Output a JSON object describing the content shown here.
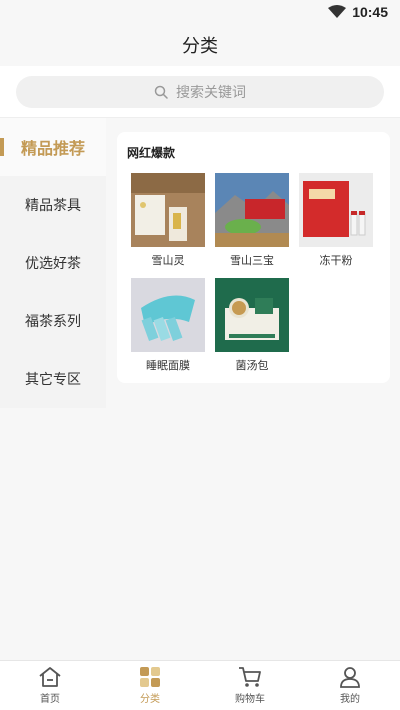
{
  "status": {
    "time": "10:45"
  },
  "header": {
    "title": "分类"
  },
  "search": {
    "placeholder": "搜索关键词"
  },
  "sidebar": {
    "items": [
      {
        "label": "精品推荐",
        "active": true
      },
      {
        "label": "精品茶具"
      },
      {
        "label": "优选好茶"
      },
      {
        "label": "福茶系列"
      },
      {
        "label": "其它专区"
      }
    ]
  },
  "section": {
    "title": "网红爆款",
    "products": [
      {
        "name": "雪山灵"
      },
      {
        "name": "雪山三宝"
      },
      {
        "name": "冻干粉"
      },
      {
        "name": "睡眠面膜"
      },
      {
        "name": "菌汤包"
      }
    ]
  },
  "tabbar": {
    "items": [
      {
        "label": "首页",
        "icon": "home-icon"
      },
      {
        "label": "分类",
        "icon": "category-icon",
        "active": true
      },
      {
        "label": "购物车",
        "icon": "cart-icon"
      },
      {
        "label": "我的",
        "icon": "user-icon"
      }
    ]
  },
  "colors": {
    "accent": "#c39a55",
    "background": "#f7f7f7"
  }
}
